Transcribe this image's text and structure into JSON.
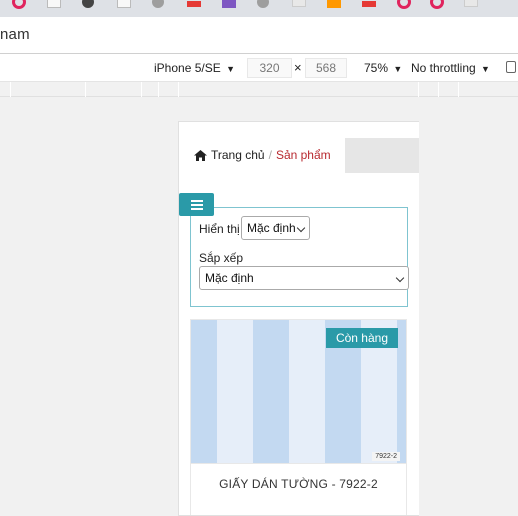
{
  "browser": {
    "address_text": "nam",
    "favicons": [
      "ring",
      "doc",
      "dark",
      "doc",
      "grey",
      "red",
      "purple",
      "grey",
      "light",
      "orange",
      "red",
      "ring",
      "ring",
      "light"
    ]
  },
  "device_toolbar": {
    "device": "iPhone 5/SE",
    "width": "320",
    "times": "×",
    "height": "568",
    "zoom": "75%",
    "throttling": "No throttling"
  },
  "page": {
    "breadcrumb": {
      "home": "Trang chủ",
      "separator": "/",
      "current": "Sản phẩm"
    },
    "filters": {
      "display_label": "Hiển thị",
      "display_value": "Mặc định",
      "sort_label": "Sắp xếp",
      "sort_value": "Mặc định"
    },
    "product": {
      "badge": "Còn hàng",
      "image_code": "7922-2",
      "name": "GIẤY DÁN TƯỜNG - 7922-2"
    }
  },
  "colors": {
    "accent": "#2a9aa8",
    "breadcrumb_current": "#b8292f",
    "stripe_dark": "#c3d9f1",
    "stripe_light": "#e6eef9"
  }
}
